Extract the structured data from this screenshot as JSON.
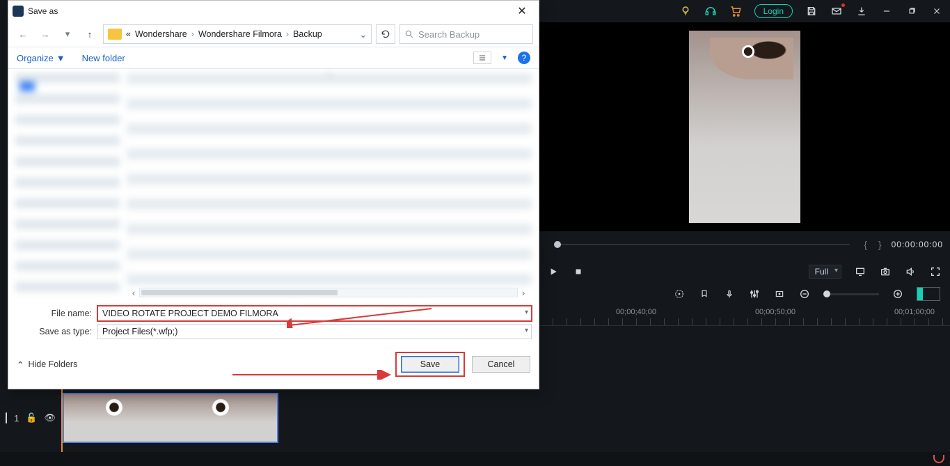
{
  "titlebar": {
    "login": "Login"
  },
  "preview": {
    "timecode": "00:00:00:00",
    "in_out": "{     }",
    "quality_label": "Full"
  },
  "ruler": {
    "t1": "00;00;40;00",
    "t2": "00;00;50;00",
    "t3": "00;01;00;00"
  },
  "track": {
    "index": "1"
  },
  "dialog": {
    "title": "Save as",
    "breadcrumb": {
      "lead": "«",
      "p1": "Wondershare",
      "p2": "Wondershare Filmora",
      "p3": "Backup"
    },
    "search_placeholder": "Search Backup",
    "toolbar": {
      "organize": "Organize",
      "new_folder": "New folder"
    },
    "filename_label": "File name:",
    "filename_value": "VIDEO ROTATE PROJECT DEMO FILMORA",
    "type_label": "Save as type:",
    "type_value": "Project Files(*.wfp;)",
    "hide_folders": "Hide Folders",
    "save": "Save",
    "cancel": "Cancel",
    "help": "?"
  }
}
